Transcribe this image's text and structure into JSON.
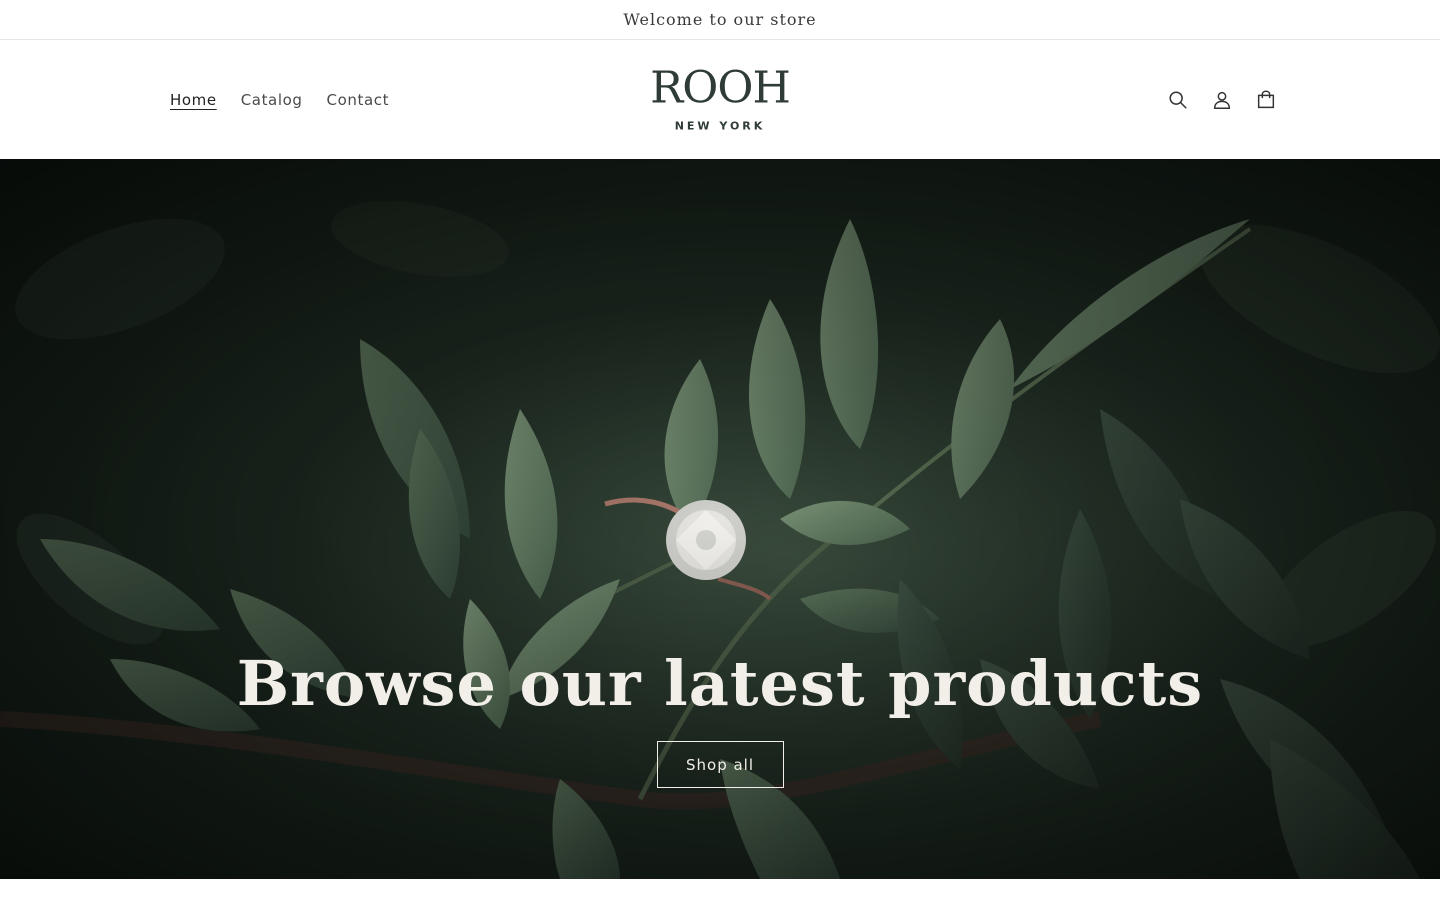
{
  "announcement": {
    "text": "Welcome to our store"
  },
  "nav": {
    "home": "Home",
    "catalog": "Catalog",
    "contact": "Contact"
  },
  "logo": {
    "main": "ROOH",
    "sub": "NEW YORK"
  },
  "icons": {
    "search": "search-icon",
    "account": "account-icon",
    "cart": "cart-icon"
  },
  "hero": {
    "title": "Browse our latest products",
    "button": "Shop all"
  },
  "colors": {
    "brand": "#2f3b36",
    "hero_text": "#f1efe8",
    "leaf": "#5f7a60"
  }
}
